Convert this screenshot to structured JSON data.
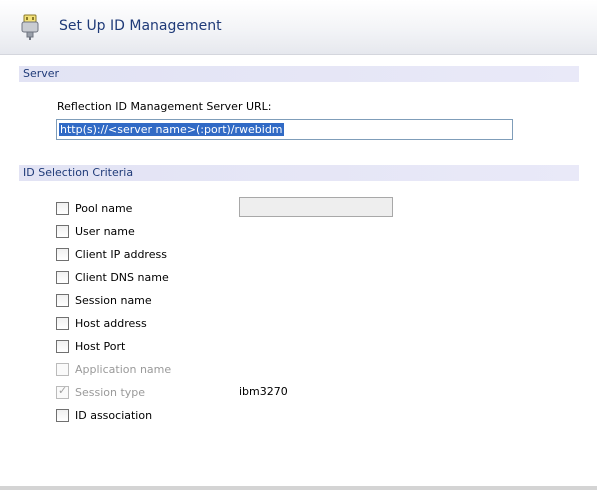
{
  "header": {
    "title": "Set Up ID Management",
    "icon": "plug-connector-icon"
  },
  "server": {
    "section_title": "Server",
    "url_label": "Reflection ID Management Server URL:",
    "url_value": "http(s)://<server name>(:port)/rwebidm"
  },
  "criteria": {
    "section_title": "ID Selection Criteria",
    "items": [
      {
        "label": "Pool name",
        "checked": false,
        "enabled": true
      },
      {
        "label": "User name",
        "checked": false,
        "enabled": true
      },
      {
        "label": "Client IP address",
        "checked": false,
        "enabled": true
      },
      {
        "label": "Client DNS name",
        "checked": false,
        "enabled": true
      },
      {
        "label": "Session name",
        "checked": false,
        "enabled": true
      },
      {
        "label": "Host address",
        "checked": false,
        "enabled": true
      },
      {
        "label": "Host Port",
        "checked": false,
        "enabled": true
      },
      {
        "label": "Application name",
        "checked": false,
        "enabled": false
      },
      {
        "label": "Session type",
        "checked": true,
        "enabled": false
      },
      {
        "label": "ID association",
        "checked": false,
        "enabled": true
      }
    ],
    "pool_name_value": "",
    "session_type_value": "ibm3270"
  }
}
